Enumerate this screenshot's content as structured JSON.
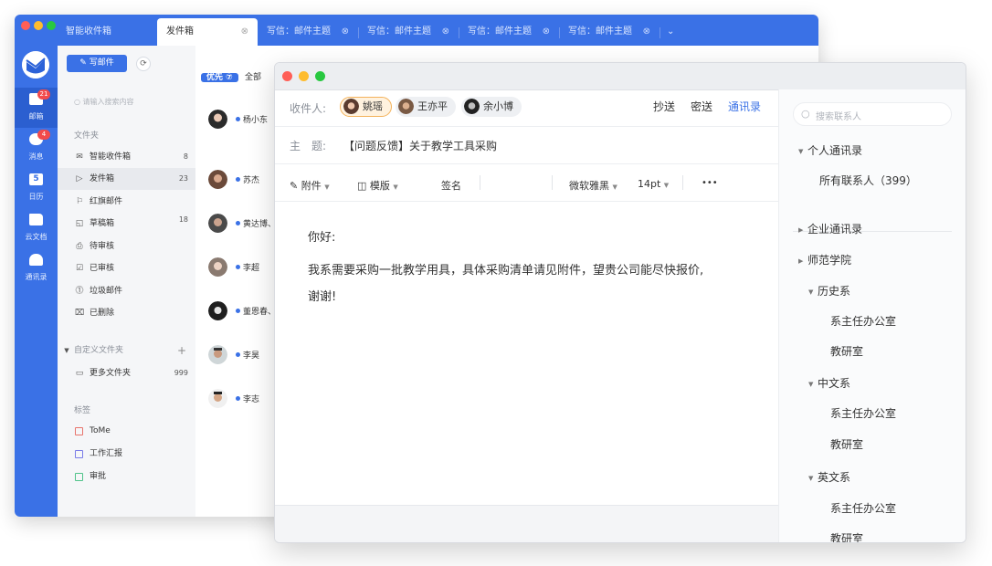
{
  "main_window": {
    "tabs": [
      {
        "label": "智能收件箱",
        "closable": false,
        "active": false
      },
      {
        "label": "发件箱",
        "closable": true,
        "active": true
      },
      {
        "label": "写信：邮件主题",
        "closable": true,
        "active": false
      },
      {
        "label": "写信：邮件主题",
        "closable": true,
        "active": false
      },
      {
        "label": "写信：邮件主题",
        "closable": true,
        "active": false
      },
      {
        "label": "写信：邮件主题",
        "closable": true,
        "active": false
      }
    ],
    "tab_overflow": "⌄"
  },
  "left_nav": {
    "items": [
      {
        "label": "邮箱",
        "icon": "mail-icon",
        "badge": "21",
        "active": true
      },
      {
        "label": "消息",
        "icon": "chat-icon",
        "badge": "4",
        "active": false
      },
      {
        "label": "日历",
        "icon": "calendar-icon",
        "badge": "",
        "active": false,
        "icon_text": "5"
      },
      {
        "label": "云文档",
        "icon": "cloud-folder-icon",
        "badge": "",
        "active": false
      },
      {
        "label": "通讯录",
        "icon": "contacts-icon",
        "badge": "",
        "active": false
      }
    ]
  },
  "folder_panel": {
    "write_button": "写邮件",
    "write_icon": "✎",
    "refresh_icon": "⟳",
    "search_placeholder": "请输入搜索内容",
    "search_icon": "○",
    "folders_title": "文件夹",
    "folders": [
      {
        "label": "智能收件箱",
        "icon": "✉",
        "count": "8",
        "active": false
      },
      {
        "label": "发件箱",
        "icon": "▷",
        "count": "23",
        "active": true
      },
      {
        "label": "红旗邮件",
        "icon": "⚐",
        "count": "",
        "active": false
      },
      {
        "label": "草稿箱",
        "icon": "◱",
        "count": "18",
        "active": false
      },
      {
        "label": "待审核",
        "icon": "⎙",
        "count": "",
        "active": false
      },
      {
        "label": "已审核",
        "icon": "☑",
        "count": "",
        "active": false
      },
      {
        "label": "垃圾邮件",
        "icon": "⓵",
        "count": "",
        "active": false
      },
      {
        "label": "已删除",
        "icon": "⌧",
        "count": "",
        "active": false
      }
    ],
    "custom_folders_title": "自定义文件夹",
    "custom_add": "+",
    "custom_folders": [
      {
        "label": "更多文件夹",
        "icon": "▭",
        "count": "999"
      }
    ],
    "tags_title": "标签",
    "tags": [
      {
        "label": "ToMe",
        "color": "#e8736b"
      },
      {
        "label": "工作汇报",
        "color": "#7a7ce8"
      },
      {
        "label": "审批",
        "color": "#4fc38a"
      }
    ]
  },
  "mail_list": {
    "filters": [
      {
        "label": "优先",
        "active": true,
        "suffix": "⑦"
      },
      {
        "label": "全部",
        "active": false
      }
    ],
    "items": [
      {
        "name": "杨小东"
      },
      {
        "name": "苏杰"
      },
      {
        "name": "黄达博、"
      },
      {
        "name": "李超"
      },
      {
        "name": "董恩春、"
      },
      {
        "name": "李昊"
      },
      {
        "name": "李志"
      }
    ]
  },
  "compose": {
    "recipients_label": "收件人:",
    "recipients": [
      {
        "name": "姚瑶",
        "selected": true
      },
      {
        "name": "王亦平",
        "selected": false
      },
      {
        "name": "余小博",
        "selected": false
      }
    ],
    "cc_label": "抄送",
    "bcc_label": "密送",
    "address_book_label": "通讯录",
    "subject_label": "主　题:",
    "subject_value": "【问题反馈】关于教学工具采购",
    "toolbar": {
      "attachment": "附件",
      "template": "模版",
      "signature": "签名",
      "font": "微软雅黑",
      "size": "14pt",
      "more": "•••"
    },
    "body_lines": [
      "你好:",
      "我系需要采购一批教学用具，具体采购清单请见附件，望贵公司能尽快报价,",
      "谢谢!"
    ]
  },
  "contacts": {
    "search_placeholder": "搜索联系人",
    "personal_title": "个人通讯录",
    "all_contacts": "所有联系人（399）",
    "enterprise_title": "企业通讯录",
    "school_title": "师范学院",
    "history_dept": "历史系",
    "history_children": [
      "系主任办公室",
      "教研室"
    ],
    "chinese_dept": "中文系",
    "chinese_children": [
      "系主任办公室",
      "教研室"
    ],
    "english_dept": "英文系",
    "english_children": [
      "系主任办公室",
      "教研室"
    ]
  }
}
